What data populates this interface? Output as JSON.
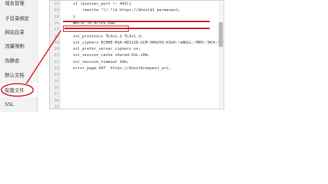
{
  "sidebar": {
    "items": [
      {
        "label": "域名管理"
      },
      {
        "label": "子目录绑定"
      },
      {
        "label": "网站目录"
      },
      {
        "label": "流量限制"
      },
      {
        "label": "伪静态"
      },
      {
        "label": "默认文档"
      },
      {
        "label": "配置文件"
      },
      {
        "label": "SSL"
      }
    ],
    "active_index": 6
  },
  "editor": {
    "lines": [
      {
        "num": "13",
        "text": "    if ($server_port !~ 443){"
      },
      {
        "num": "14",
        "text": "        rewrite ^(/.*)$ https://$host$1 permanent;"
      },
      {
        "num": "15",
        "text": "    }"
      },
      {
        "num": "16",
        "text": "    #HTTP_TO_HTTPS_END"
      },
      {
        "num": "17",
        "text": ""
      },
      {
        "num": "18",
        "text": "    ssl_protocols TLSv1.2 TLSv1.3;"
      },
      {
        "num": "19",
        "text": "    ssl_ciphers ECDHE-RSA-AES128-GCM-SHA256:HIGH:!aNULL:!MD5:!RC4:!DHE;"
      },
      {
        "num": "20",
        "text": "    ssl_prefer_server_ciphers on;"
      },
      {
        "num": "21",
        "text": "    ssl_session_cache shared:SSL:10m;"
      },
      {
        "num": "22",
        "text": "    ssl_session_timeout 10m;"
      },
      {
        "num": "23",
        "text": "    error_page 497  https://$host$request_uri;"
      },
      {
        "num": "24",
        "text": ""
      },
      {
        "num": "25",
        "text": ""
      },
      {
        "num": "26",
        "text": ""
      },
      {
        "num": "27",
        "text": ""
      },
      {
        "num": "28",
        "text": ""
      },
      {
        "num": "29",
        "text": ""
      }
    ]
  },
  "colors": {
    "annotation_red": "#d6141d",
    "sidebar_bg": "#f2f2f2"
  }
}
